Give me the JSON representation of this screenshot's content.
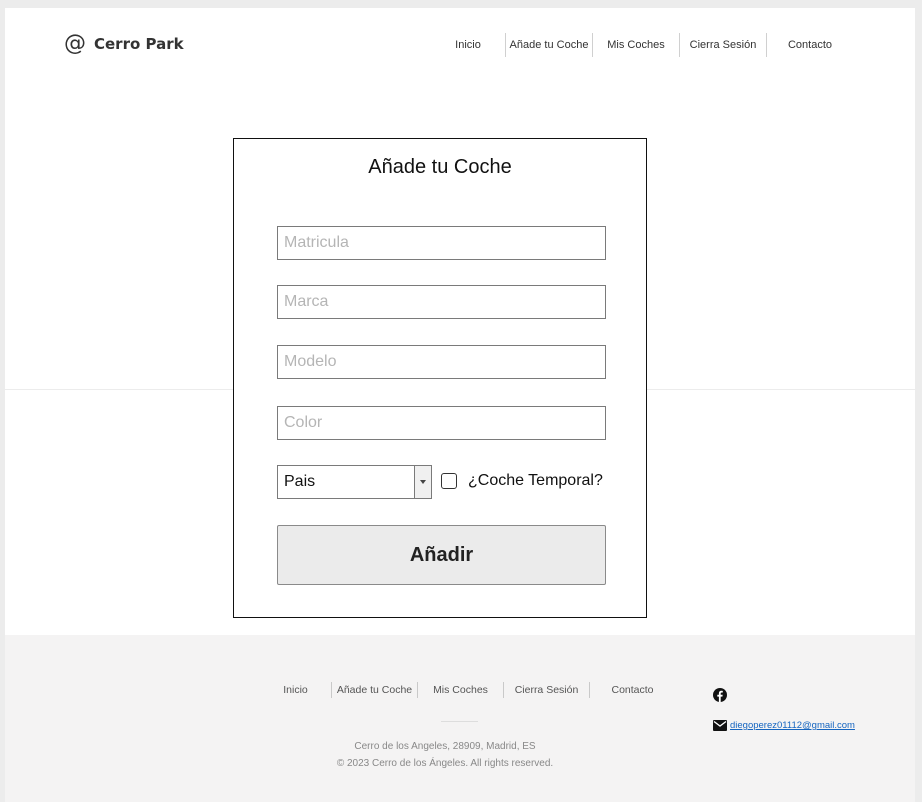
{
  "brand": {
    "logo_glyph": "@",
    "name": "Cerro Park"
  },
  "nav": {
    "items": [
      {
        "label": "Inicio"
      },
      {
        "label": "Añade tu Coche"
      },
      {
        "label": "Mis Coches"
      },
      {
        "label": "Cierra Sesión"
      },
      {
        "label": "Contacto"
      }
    ]
  },
  "form": {
    "title": "Añade tu Coche",
    "fields": {
      "matricula_placeholder": "Matricula",
      "marca_placeholder": "Marca",
      "modelo_placeholder": "Modelo",
      "color_placeholder": "Color"
    },
    "country_select": {
      "value": "Pais"
    },
    "temporal_checkbox": {
      "label": "¿Coche Temporal?",
      "checked": false
    },
    "submit_label": "Añadir"
  },
  "footer": {
    "nav": [
      {
        "label": "Inicio"
      },
      {
        "label": "Añade tu Coche"
      },
      {
        "label": "Mis Coches"
      },
      {
        "label": "Cierra Sesión"
      },
      {
        "label": "Contacto"
      }
    ],
    "address": "Cerro de los Angeles, 28909, Madrid, ES",
    "copyright": "© 2023 Cerro de los Ángeles.  All rights reserved.",
    "email": "diegoperez01112@gmail.com",
    "icons": [
      "facebook-icon",
      "mail-icon"
    ]
  },
  "colors": {
    "page_bg": "#ececec",
    "footer_bg": "#f4f3f3",
    "link": "#1565c0",
    "text_dark": "#333333"
  }
}
